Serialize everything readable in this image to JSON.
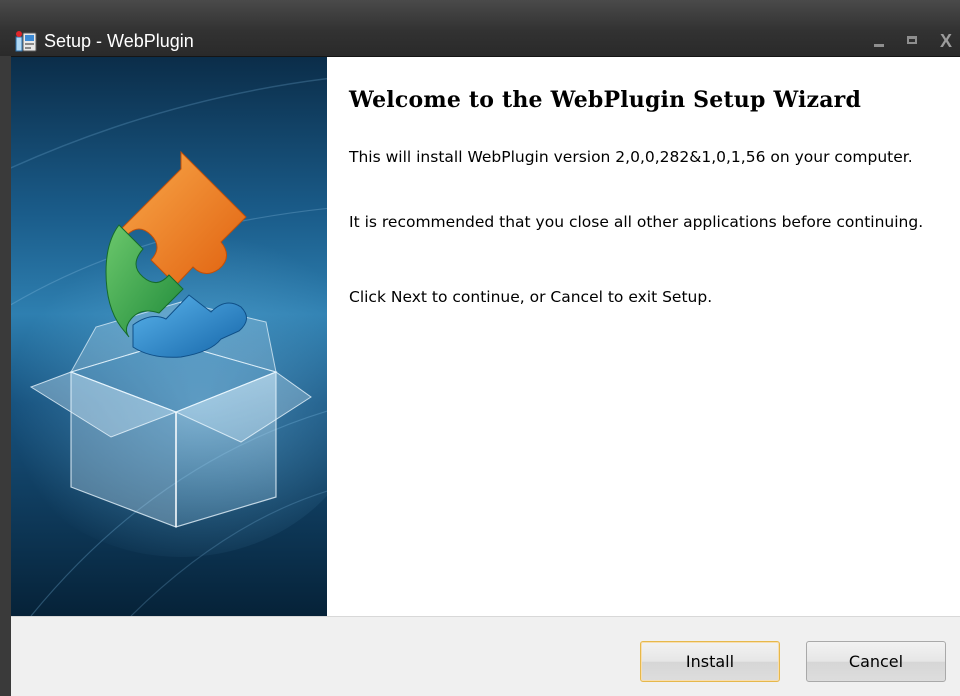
{
  "window": {
    "title": "Setup - WebPlugin",
    "controls": {
      "minimize": "_",
      "close": "X"
    }
  },
  "content": {
    "heading": "Welcome to the WebPlugin Setup Wizard",
    "paragraphs": [
      "This will install WebPlugin version 2,0,0,282&1,0,1,56 on your computer.",
      "It is recommended that you close all other applications before continuing.",
      "Click Next to continue, or Cancel to exit Setup."
    ]
  },
  "footer": {
    "install_label": "Install",
    "cancel_label": "Cancel"
  },
  "icons": {
    "app": "setup-installer-icon",
    "banner": "puzzle-box-illustration"
  },
  "colors": {
    "titlebar": "#333333",
    "banner_dark": "#0a2b45",
    "banner_light": "#2f7fae",
    "puzzle_orange": "#ef7b1c",
    "puzzle_green": "#3aa64c",
    "puzzle_blue": "#1e86c8",
    "default_button_border": "#e6b84b"
  }
}
